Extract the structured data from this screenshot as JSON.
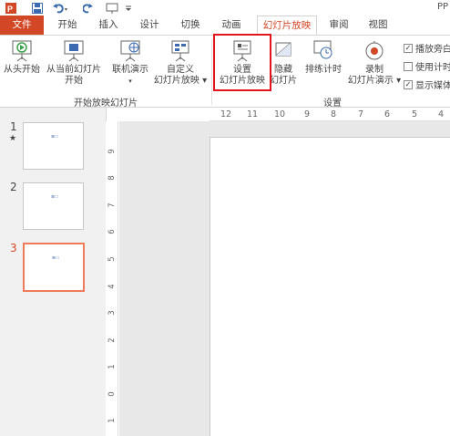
{
  "app": {
    "title": "PP"
  },
  "qat": {
    "icons": [
      "powerpoint-logo",
      "save",
      "undo",
      "redo",
      "present-from-beginning",
      "customize"
    ]
  },
  "tabs": [
    {
      "label": "文件",
      "kind": "file"
    },
    {
      "label": "开始"
    },
    {
      "label": "插入"
    },
    {
      "label": "设计"
    },
    {
      "label": "切换"
    },
    {
      "label": "动画"
    },
    {
      "label": "幻灯片放映",
      "active": true
    },
    {
      "label": "审阅"
    },
    {
      "label": "视图"
    }
  ],
  "ribbon": {
    "from_beginning": "从头开始",
    "from_current_1": "从当前幻灯片",
    "from_current_2": "开始",
    "online_present_1": "联机演示",
    "online_present_2": "▾",
    "custom_show_1": "自定义",
    "custom_show_2": "幻灯片放映 ▾",
    "group_start": "开始放映幻灯片",
    "setup_show_1": "设置",
    "setup_show_2": "幻灯片放映",
    "hide_slide_1": "隐藏",
    "hide_slide_2": "幻灯片",
    "rehearse": "排练计时",
    "record_1": "录制",
    "record_2": "幻灯片演示 ▾",
    "group_setup": "设置",
    "play_narrations": "播放旁白",
    "use_timings": "使用计时",
    "show_media": "显示媒体",
    "play_narrations_checked": true,
    "use_timings_checked": false,
    "show_media_checked": true
  },
  "slides": [
    {
      "number": "1",
      "star": "★",
      "active": false
    },
    {
      "number": "2",
      "star": "",
      "active": false
    },
    {
      "number": "3",
      "star": "",
      "active": true
    }
  ],
  "hruler": [
    "12",
    "11",
    "10",
    "9",
    "8",
    "7",
    "6",
    "5",
    "4"
  ],
  "vruler": [
    "9",
    "8",
    "7",
    "6",
    "5",
    "4",
    "3",
    "2",
    "1",
    "0",
    "1"
  ],
  "colors": {
    "accent": "#d24726",
    "highlight": "#e3141b"
  }
}
